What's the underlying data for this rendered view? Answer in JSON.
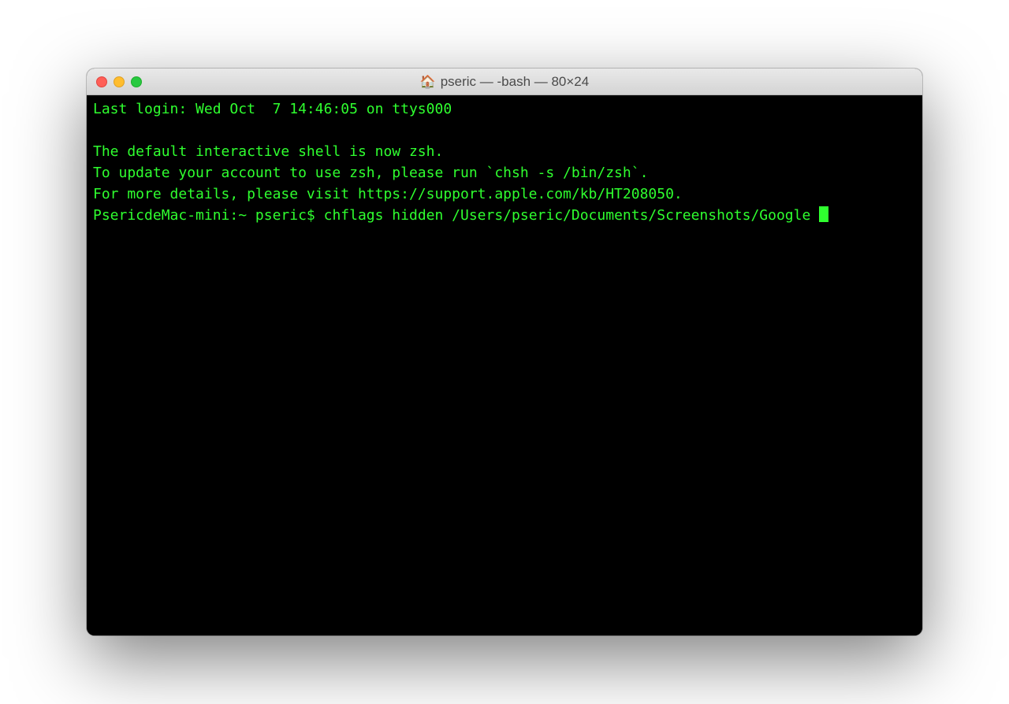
{
  "window": {
    "title": "pseric — -bash — 80×24",
    "title_icon": "🏠"
  },
  "terminal": {
    "last_login": "Last login: Wed Oct  7 14:46:05 on ttys000",
    "blank1": "",
    "zsh_msg1": "The default interactive shell is now zsh.",
    "zsh_msg2": "To update your account to use zsh, please run `chsh -s /bin/zsh`.",
    "zsh_msg3": "For more details, please visit https://support.apple.com/kb/HT208050.",
    "prompt": "PsericdeMac-mini:~ pseric$ ",
    "command": "chflags hidden /Users/pseric/Documents/Screenshots/Google "
  }
}
